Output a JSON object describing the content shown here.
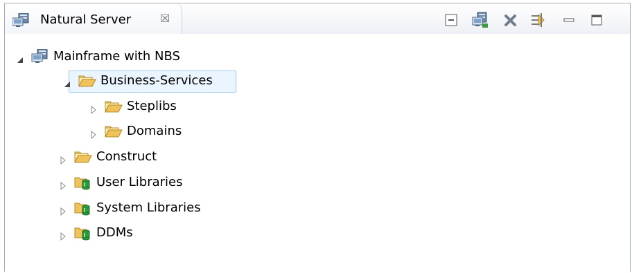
{
  "view": {
    "tab_label": "Natural Server",
    "tab_close_symbol": "☒",
    "toolbar": [
      {
        "name": "collapse-all-button",
        "icon": "collapse-all-icon"
      },
      {
        "name": "connect-server-button",
        "icon": "server-icon"
      },
      {
        "name": "remove-button",
        "icon": "x-icon"
      },
      {
        "name": "link-with-editor-button",
        "icon": "link-icon"
      },
      {
        "name": "minimize-button",
        "icon": "minimize-icon"
      },
      {
        "name": "maximize-button",
        "icon": "maximize-icon"
      }
    ]
  },
  "tree": {
    "root": {
      "label": "Mainframe with NBS",
      "icon": "server-icon",
      "expanded": true
    },
    "business_services": {
      "label": "Business-Services",
      "icon": "folder-open-icon",
      "expanded": true,
      "selected": true
    },
    "steplibs": {
      "label": "Steplibs",
      "icon": "folder-open-icon",
      "expanded": false
    },
    "domains": {
      "label": "Domains",
      "icon": "folder-open-icon",
      "expanded": false
    },
    "construct": {
      "label": "Construct",
      "icon": "folder-open-icon",
      "expanded": false
    },
    "user_libraries": {
      "label": "User Libraries",
      "icon": "library-folder-icon",
      "expanded": false
    },
    "system_libraries": {
      "label": "System Libraries",
      "icon": "library-folder-icon",
      "expanded": false
    },
    "ddms": {
      "label": "DDMs",
      "icon": "library-folder-icon",
      "expanded": false
    }
  },
  "colors": {
    "folder": "#f0c35a",
    "library_cylinder": "#2e9b3a",
    "selection_bg": "#eaf5ff",
    "selection_border": "#9ec9ec"
  }
}
